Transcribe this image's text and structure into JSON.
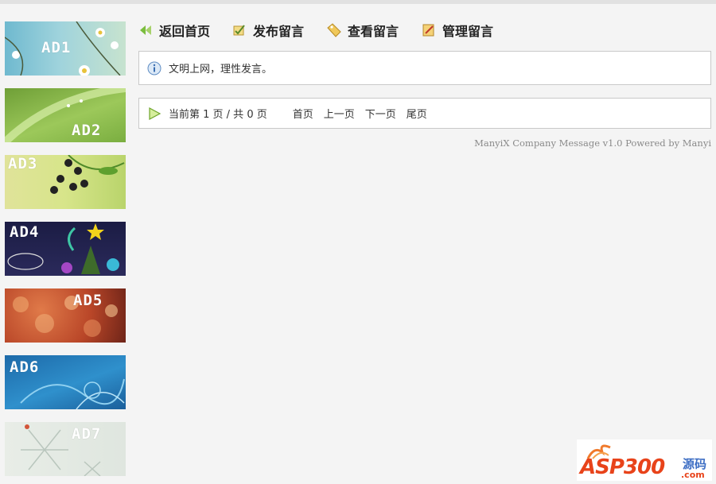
{
  "sidebar": {
    "ads": [
      {
        "label": "AD1"
      },
      {
        "label": "AD2"
      },
      {
        "label": "AD3"
      },
      {
        "label": "AD4"
      },
      {
        "label": "AD5"
      },
      {
        "label": "AD6"
      },
      {
        "label": "AD7"
      }
    ]
  },
  "nav": {
    "items": [
      {
        "label": "返回首页",
        "icon": "back-arrow-icon"
      },
      {
        "label": "发布留言",
        "icon": "pencil-check-icon"
      },
      {
        "label": "查看留言",
        "icon": "tag-icon"
      },
      {
        "label": "管理留言",
        "icon": "edit-note-icon"
      }
    ]
  },
  "notice": {
    "text": "文明上网，理性发言。",
    "icon": "info-icon"
  },
  "pager": {
    "info": "当前第 1 页 / 共 0 页",
    "icon": "play-icon",
    "links": [
      "首页",
      "上一页",
      "下一页",
      "尾页"
    ]
  },
  "footer": {
    "credit": "ManyiX Company Message v1.0 Powered by Manyi"
  },
  "watermark": {
    "brand": "ASP300",
    "cn": "源码",
    "domain": ".com"
  },
  "colors": {
    "background": "#f4f4f4",
    "border": "#c9c9c9",
    "brand_orange": "#e8431a",
    "brand_blue": "#3d6ec4"
  }
}
